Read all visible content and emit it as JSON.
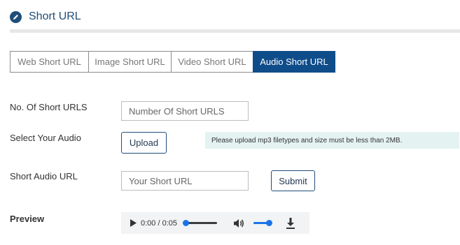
{
  "header": {
    "title": "Short URL",
    "icon": "pencil-icon",
    "accent": "#1f4e79"
  },
  "tabs": [
    {
      "label": "Web Short URL",
      "active": false
    },
    {
      "label": "Image Short URL",
      "active": false
    },
    {
      "label": "Video Short URL",
      "active": false
    },
    {
      "label": "Audio Short URL",
      "active": true
    }
  ],
  "form": {
    "count": {
      "label": "No. Of Short URLS",
      "placeholder": "Number Of Short URLS",
      "value": ""
    },
    "audio": {
      "label": "Select Your Audio",
      "upload_label": "Upload",
      "hint": "Please upload mp3 filetypes and size must be less than 2MB."
    },
    "short_url": {
      "label": "Short Audio URL",
      "placeholder": "Your Short URL",
      "value": "",
      "submit_label": "Submit"
    },
    "preview": {
      "label": "Preview",
      "player": {
        "time": "0:00 / 0:05",
        "progress": 0,
        "volume": 1
      }
    }
  }
}
